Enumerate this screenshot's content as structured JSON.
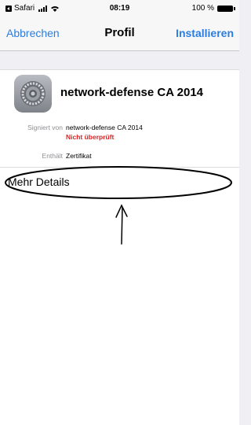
{
  "status_bar": {
    "back_app": "Safari",
    "time": "08:19",
    "battery": "100 %"
  },
  "nav": {
    "cancel": "Abbrechen",
    "title": "Profil",
    "install": "Installieren"
  },
  "profile": {
    "name": "network-defense CA 2014",
    "icon": "settings-gear-icon"
  },
  "details": {
    "signed_label": "Signiert von",
    "signed_value": "network-defense CA 2014",
    "verification": "Nicht überprüft",
    "contains_label": "Enthält",
    "contains_value": "Zertifikat"
  },
  "more": {
    "label": "Mehr Details"
  },
  "colors": {
    "accent": "#2b7de1",
    "warning": "#e02020"
  }
}
